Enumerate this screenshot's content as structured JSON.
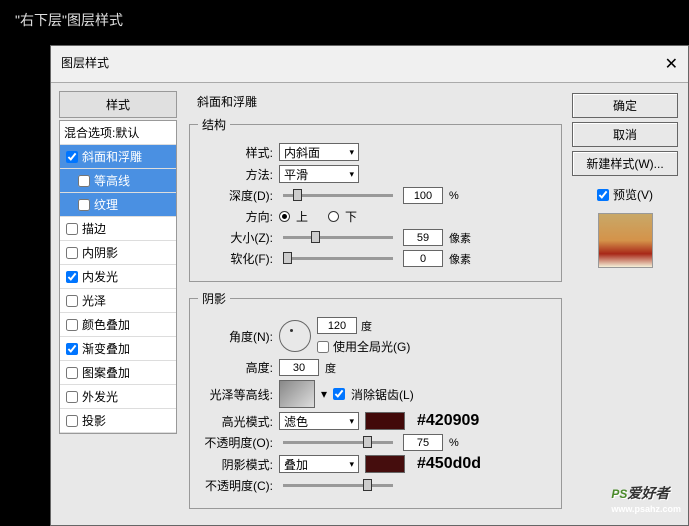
{
  "outer_title": "\"右下层\"图层样式",
  "dialog_title": "图层样式",
  "styles_header": "样式",
  "blend_row": "混合选项:默认",
  "style_items": [
    {
      "label": "斜面和浮雕",
      "checked": true,
      "selected": true,
      "sub": false
    },
    {
      "label": "等高线",
      "checked": false,
      "selected": true,
      "sub": true
    },
    {
      "label": "纹理",
      "checked": false,
      "selected": true,
      "sub": true
    },
    {
      "label": "描边",
      "checked": false,
      "selected": false,
      "sub": false
    },
    {
      "label": "内阴影",
      "checked": false,
      "selected": false,
      "sub": false
    },
    {
      "label": "内发光",
      "checked": true,
      "selected": false,
      "sub": false
    },
    {
      "label": "光泽",
      "checked": false,
      "selected": false,
      "sub": false
    },
    {
      "label": "颜色叠加",
      "checked": false,
      "selected": false,
      "sub": false
    },
    {
      "label": "渐变叠加",
      "checked": true,
      "selected": false,
      "sub": false
    },
    {
      "label": "图案叠加",
      "checked": false,
      "selected": false,
      "sub": false
    },
    {
      "label": "外发光",
      "checked": false,
      "selected": false,
      "sub": false
    },
    {
      "label": "投影",
      "checked": false,
      "selected": false,
      "sub": false
    }
  ],
  "section_title": "斜面和浮雕",
  "structure": {
    "legend": "结构",
    "style_label": "样式:",
    "style_value": "内斜面",
    "tech_label": "方法:",
    "tech_value": "平滑",
    "depth_label": "深度(D):",
    "depth_value": "100",
    "depth_unit": "%",
    "dir_label": "方向:",
    "dir_up": "上",
    "dir_down": "下",
    "size_label": "大小(Z):",
    "size_value": "59",
    "size_unit": "像素",
    "soft_label": "软化(F):",
    "soft_value": "0",
    "soft_unit": "像素"
  },
  "shadow": {
    "legend": "阴影",
    "angle_label": "角度(N):",
    "angle_value": "120",
    "angle_unit": "度",
    "global_label": "使用全局光(G)",
    "alt_label": "高度:",
    "alt_value": "30",
    "alt_unit": "度",
    "contour_label": "光泽等高线:",
    "antialias_label": "消除锯齿(L)",
    "hl_label": "高光模式:",
    "hl_mode": "滤色",
    "hl_hex": "#420909",
    "hl_op_label": "不透明度(O):",
    "hl_op_value": "75",
    "hl_op_unit": "%",
    "sh_label": "阴影模式:",
    "sh_mode": "叠加",
    "sh_hex": "#450d0d",
    "sh_op_label": "不透明度(C):"
  },
  "buttons": {
    "ok": "确定",
    "cancel": "取消",
    "new": "新建样式(W)...",
    "preview": "预览(V)"
  },
  "watermark": {
    "main": "PS",
    "sub": "www.psahz.com",
    "tag": "爱好者"
  }
}
